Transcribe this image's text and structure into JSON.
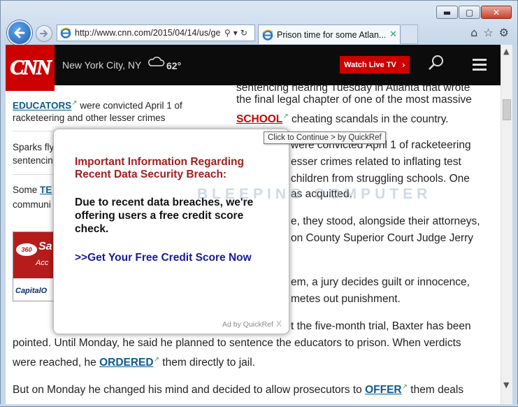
{
  "browser": {
    "url": "http://www.cnn.com/2015/04/14/us/ge",
    "tab_title": "Prison time for some Atlan...",
    "win_minimize": "▬",
    "win_maximize": "▢",
    "win_close": "✕",
    "tab_close": "✕",
    "addr_search_icon": "⚲",
    "addr_dropdown_icon": "▾",
    "addr_refresh_icon": "↻",
    "tools_home": "⌂",
    "tools_favorites": "☆",
    "tools_settings": "⚙"
  },
  "cnn": {
    "logo": "CNN",
    "location": "New York City, NY",
    "weather_icon": "cloud-icon",
    "temperature": "62°",
    "watch_live": "Watch Live TV",
    "watch_live_chevron": "›",
    "accent": "#cc0000"
  },
  "sidebar": {
    "item1_link": "EDUCATORS",
    "item1_line1_rest": " were convicted April 1 of",
    "item1_line2": "racketeering and other lesser crimes",
    "item2_line1": "Sparks fly",
    "item2_line2": "sentencin",
    "item3_prefix": "Some ",
    "item3_link": "TE",
    "item3_line2": "communi",
    "ad_360": "360",
    "ad_sa": "Sa",
    "ad_acc": "Acc",
    "ad_capital": "CapitalO"
  },
  "article": {
    "line0": "sentencing hearing Tuesday in Atlanta that wrote",
    "line1": "the final legal chapter of one of the most massive",
    "school": "SCHOOL",
    "line2_rest": " cheating scandals in the country.",
    "line3": "were convicted April 1 of racketeering",
    "line4": "esser crimes related to inflating test",
    "line5": "children from struggling schools. One",
    "line6": "as acquitted.",
    "line7": "e, they stood, alongside their attorneys,",
    "line8": "on County Superior Court Judge Jerry",
    "line9": "em, a jury decides guilt or innocence,",
    "line10": "metes out punishment.",
    "line11": "t the five-month trial, Baxter has been",
    "line12": "pointed. Until Monday, he said he planned to sentence the educators to prison. When verdicts",
    "line13_pre": "were reached, he ",
    "ordered": "ORDERED",
    "line13_post": " them directly to jail.",
    "line14_pre": "But on Monday he changed his mind and decided to allow prosecutors to ",
    "offer": "OFFER",
    "line14_post": " them deals"
  },
  "tooltip": "Click to Continue > by QuickRef",
  "popup": {
    "heading": "Important Information Regarding Recent Data Security Breach:",
    "body": "Due to recent data breaches, we're offering users a free credit score check.",
    "cta": ">>Get Your Free Credit Score Now",
    "ad_by": "Ad by QuickRef",
    "close": "X"
  },
  "watermark": "BLEEPING COMPUTER",
  "scroll": {
    "up": "▲",
    "down": "▼"
  }
}
